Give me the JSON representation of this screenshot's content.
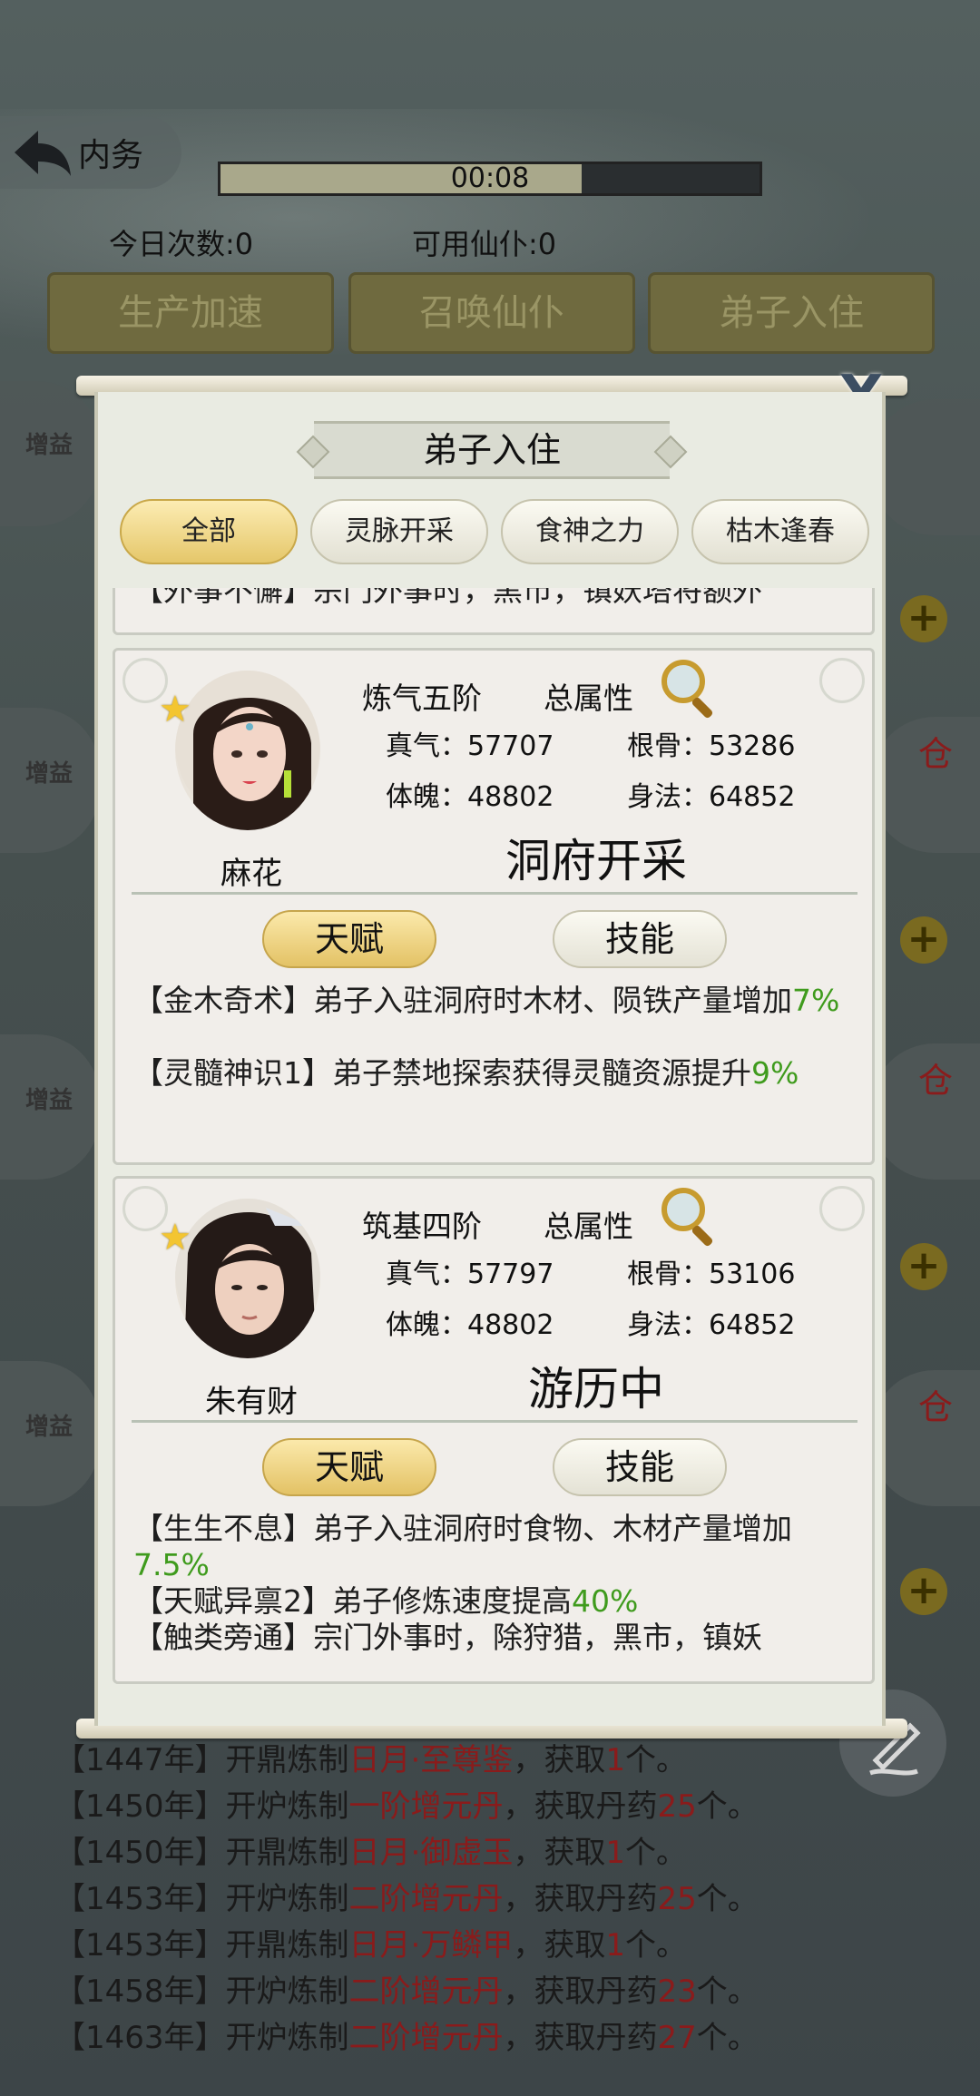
{
  "header": {
    "back_label": "内务",
    "timer": "00:08",
    "timer_progress": 0.67,
    "today_count": "今日次数:0",
    "available_servants": "可用仙仆:0"
  },
  "top_buttons": [
    "生产加速",
    "召唤仙仆",
    "弟子入住"
  ],
  "side": {
    "boost_label": "增益",
    "cang_label": "仓",
    "plus_label": "+"
  },
  "modal": {
    "title": "弟子入住",
    "close_label": "X",
    "tabs": [
      "全部",
      "灵脉开采",
      "食神之力",
      "枯木逢春"
    ],
    "partial_top_text": "【外事不懈】宗门外事时，黑市，镇妖塔将额外",
    "disciples": [
      {
        "name": "麻花",
        "rank": "炼气五阶",
        "total_label": "总属性",
        "stats": {
          "zhenqi": "真气：57707",
          "gengu": "根骨：53286",
          "tipo": "体魄：48802",
          "shenfa": "身法：64852"
        },
        "status": "洞府开采",
        "tab_talent": "天赋",
        "tab_skill": "技能",
        "talents": [
          {
            "text": "【金木奇术】弟子入驻洞府时木材、陨铁产量增加",
            "value": "7%"
          },
          {
            "text": "【灵髓神识1】弟子禁地探索获得灵髓资源提升",
            "value": "9%"
          }
        ]
      },
      {
        "name": "朱有财",
        "rank": "筑基四阶",
        "total_label": "总属性",
        "stats": {
          "zhenqi": "真气：57797",
          "gengu": "根骨：53106",
          "tipo": "体魄：48802",
          "shenfa": "身法：64852"
        },
        "status": "游历中",
        "tab_talent": "天赋",
        "tab_skill": "技能",
        "talents": [
          {
            "text": "【生生不息】弟子入驻洞府时食物、木材产量增加",
            "value": "7.5%"
          },
          {
            "text": "【天赋异禀2】弟子修炼速度提高",
            "value": "40%"
          },
          {
            "text": "【触类旁通】宗门外事时，除狩猎，黑市，镇妖",
            "value": ""
          }
        ]
      }
    ]
  },
  "log": [
    {
      "a": "【1447年】开鼎炼制",
      "b": "日月·至尊鉴",
      "c": "，获取",
      "d": "1",
      "e": "个。"
    },
    {
      "a": "【1450年】开炉炼制",
      "b": "一阶增元丹",
      "c": "，获取丹药",
      "d": "25",
      "e": "个。"
    },
    {
      "a": "【1450年】开鼎炼制",
      "b": "日月·御虚玉",
      "c": "，获取",
      "d": "1",
      "e": "个。"
    },
    {
      "a": "【1453年】开炉炼制",
      "b": "二阶增元丹",
      "c": "，获取丹药",
      "d": "25",
      "e": "个。"
    },
    {
      "a": "【1453年】开鼎炼制",
      "b": "日月·万鳞甲",
      "c": "，获取",
      "d": "1",
      "e": "个。"
    },
    {
      "a": "【1458年】开炉炼制",
      "b": "二阶增元丹",
      "c": "，获取丹药",
      "d": "23",
      "e": "个。"
    },
    {
      "a": "【1463年】开炉炼制",
      "b": "二阶增元丹",
      "c": "，获取丹药",
      "d": "27",
      "e": "个。"
    }
  ],
  "colors": {
    "accent_gold": "#e5c76a",
    "talent_green": "#3f9b1d",
    "log_red": "#8a1b1b"
  }
}
